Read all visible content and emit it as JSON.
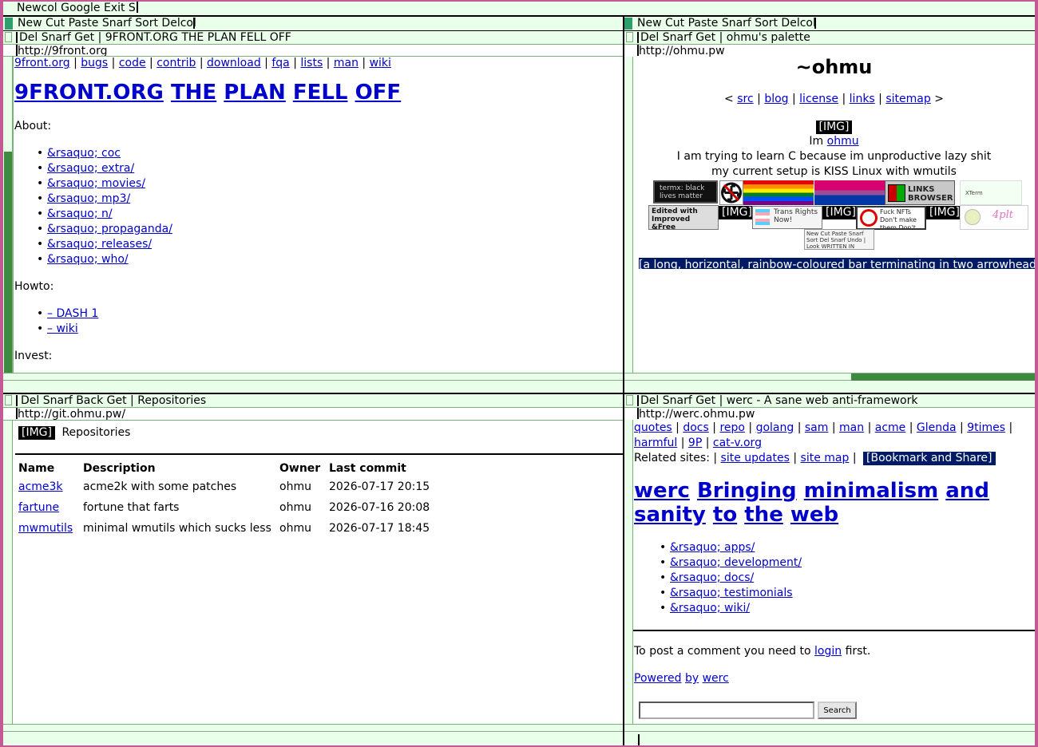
{
  "top_tagbar": {
    "text": "Newcol Google Exit S"
  },
  "columns": [
    {
      "tagbar": "New Cut Paste Snarf Sort Delcol"
    },
    {
      "tagbar": "New Cut Paste Snarf Sort Delcol"
    }
  ],
  "windows": {
    "w9front": {
      "tag": "Del Snarf Get | 9FRONT.ORG THE PLAN FELL OFF",
      "url": "http://9front.org",
      "nav": [
        "9front.org",
        "bugs",
        "code",
        "contrib",
        "download",
        "fqa",
        "lists",
        "man",
        "wiki"
      ],
      "title_words": [
        "9FRONT.ORG",
        "THE",
        "PLAN",
        "FELL",
        "OFF"
      ],
      "about_label": "About:",
      "about_items": [
        "&rsaquo; coc",
        "&rsaquo; extra/",
        "&rsaquo; movies/",
        "&rsaquo; mp3/",
        "&rsaquo; n/",
        "&rsaquo; propaganda/",
        "&rsaquo; releases/",
        "&rsaquo; who/"
      ],
      "howto_label": "Howto:",
      "howto_items": [
        "– DASH 1",
        "– wiki"
      ],
      "invest_label": "Invest:"
    },
    "ohmu": {
      "tag": "Del Snarf Get | ohmu's palette",
      "url": "http://ohmu.pw",
      "title": "~ohmu",
      "nav_open": "<",
      "nav": [
        "src",
        "blog",
        "license",
        "links",
        "sitemap"
      ],
      "nav_close": ">",
      "img_tag": "[IMG]",
      "intro_prefix": "Im",
      "intro_link": "ohmu",
      "line1": "I am trying to learn C because im unproductive lazy shit",
      "line2": "my current setup is KISS Linux with wmutils",
      "badges": {
        "blm": "termx: black lives matter",
        "links": "LINKS BROWSER",
        "xterm": "XTerm",
        "edited": "Edited with Improved &Free",
        "img1": "[IMG]",
        "trans": "Trans Rights Now!",
        "img2": "[IMG]",
        "nfts": "Fuck NFTs Don't make them Don't buy them",
        "img3": "[IMG]",
        "plt": "4plt",
        "acme": "New Cut Paste Snarf Sort Del Snarf Undo | Look WRITTEN IN ACME"
      },
      "alt_bar": "[a long, horizontal, rainbow-coloured bar terminating in two arrowheads]"
    },
    "git": {
      "tag": "Del Snarf Back Get | Repositories",
      "url": "http://git.ohmu.pw/",
      "img_tag": "[IMG]",
      "heading": "Repositories",
      "columns": [
        "Name",
        "Description",
        "Owner",
        "Last commit"
      ],
      "rows": [
        {
          "name": "acme3k",
          "description": "acme2k with some patches",
          "owner": "ohmu",
          "last_commit": "2026-07-17 20:15"
        },
        {
          "name": "fartune",
          "description": "fortune that farts",
          "owner": "ohmu",
          "last_commit": "2026-07-16 20:08"
        },
        {
          "name": "mwmutils",
          "description": "minimal wmutils which sucks less",
          "owner": "ohmu",
          "last_commit": "2026-07-17 18:45"
        }
      ]
    },
    "werc": {
      "tag": "Del Snarf Get | werc - A sane web anti-framework",
      "url": "http://werc.ohmu.pw",
      "nav1": [
        "quotes",
        "docs",
        "repo",
        "golang",
        "sam",
        "man",
        "acme",
        "Glenda",
        "9times"
      ],
      "nav2": [
        "harmful",
        "9P",
        "cat-v.org"
      ],
      "related_label": "Related sites: |",
      "related_links": [
        "site updates",
        "site map"
      ],
      "bookmark": "[Bookmark and Share]",
      "title_line1": [
        "werc",
        "Bringing",
        "minimalism",
        "and"
      ],
      "title_line2": [
        "sanity",
        "to",
        "the",
        "web"
      ],
      "items": [
        "&rsaquo; apps/",
        "&rsaquo; development/",
        "&rsaquo; docs/",
        "&rsaquo; testimonials",
        "&rsaquo; wiki/"
      ],
      "comment_prefix": "To post a comment you need to",
      "comment_link": "login",
      "comment_suffix": "first.",
      "powered_by": [
        "Powered",
        "by",
        "werc"
      ],
      "search_button": "Search",
      "search_value": ""
    }
  },
  "colors": {
    "tag_bg": "#eaffea",
    "border": "#c35a96",
    "link": "#0000cc",
    "scroll": "#3e8a3e"
  }
}
